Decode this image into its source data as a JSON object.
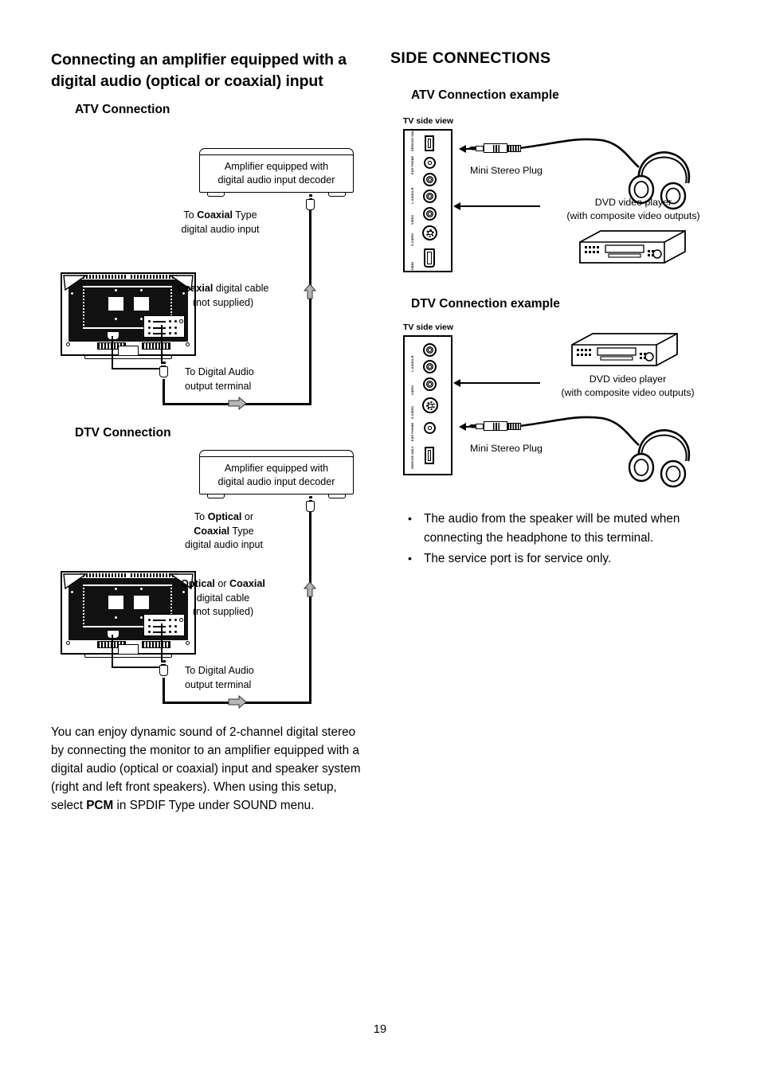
{
  "page": {
    "number": "19"
  },
  "left_column": {
    "heading": "Connecting an amplifier equipped with a digital audio (optical or coaxial) input",
    "atv": {
      "sub_heading": "ATV Connection",
      "amplifier_box": "Amplifier equipped with digital audio input decoder",
      "amplifier_box_line1": "Amplifier equipped with",
      "amplifier_box_line2": "digital audio input decoder",
      "to_input_line1_pre": "To ",
      "to_input_line1_bold": "Coaxial",
      "to_input_line1_post": " Type",
      "to_input_line2": "digital audio input",
      "cable_label_bold": "Coaxial",
      "cable_label_post": " digital cable",
      "cable_label_line2": "(not supplied)",
      "output_terminal_line1": "To Digital Audio",
      "output_terminal_line2": "output terminal"
    },
    "dtv": {
      "sub_heading": "DTV Connection",
      "amplifier_box_line1": "Amplifier equipped with",
      "amplifier_box_line2": "digital audio input decoder",
      "to_input_line1_pre": "To ",
      "to_input_line1_bold": "Optical",
      "to_input_line1_post": " or",
      "to_input_line2_bold": "Coaxial",
      "to_input_line2_post": " Type",
      "to_input_line3": "digital audio input",
      "cable_label_bold1": "Optical",
      "cable_label_mid": " or ",
      "cable_label_bold2": "Coaxial",
      "cable_label_line2": "digital cable",
      "cable_label_line3": "(not supplied)",
      "output_terminal_line1": "To Digital Audio",
      "output_terminal_line2": "output terminal"
    },
    "paragraph": "You can enjoy dynamic sound of 2-channel digital stereo by connecting the monitor to an amplifier equipped with a digital audio (optical or coaxial) input and speaker system (right and left front speakers). When using this setup, select PCM in SPDIF Type under SOUND menu.",
    "paragraph_part1": "You can enjoy dynamic sound of 2-channel digital stereo by connecting the monitor to an amplifier equipped with a digital audio (optical or coaxial) input and speaker system (right and left front speakers). When using this setup, select ",
    "paragraph_bold": "PCM",
    "paragraph_part2": " in SPDIF Type under SOUND menu."
  },
  "right_column": {
    "heading": "SIDE CONNECTIONS",
    "atv_example": {
      "sub_heading": "ATV Connection example",
      "side_view_label": "TV side view",
      "mini_stereo_plug": "Mini Stereo Plug",
      "dvd_line1": "DVD video player",
      "dvd_line2": "(with composite video outputs)",
      "panel_ports": [
        "SERVICE ONLY",
        "EAR PHONE",
        "L-AUDIO-R",
        "L-AUDIO-R",
        "VIDEO",
        "S-VIDEO",
        "HDMI"
      ]
    },
    "dtv_example": {
      "sub_heading": "DTV Connection example",
      "side_view_label": "TV side view",
      "mini_stereo_plug": "Mini Stereo Plug",
      "dvd_line1": "DVD video player",
      "dvd_line2": "(with composite video outputs)",
      "panel_ports": [
        "L-AUDIO-R",
        "L-AUDIO-R",
        "VIDEO",
        "S-VIDEO",
        "EAR PHONE",
        "SERVICE ONLY"
      ]
    },
    "notes": [
      "The audio from the speaker will be muted when connecting the headphone to this terminal.",
      "The service port is for service only."
    ]
  }
}
